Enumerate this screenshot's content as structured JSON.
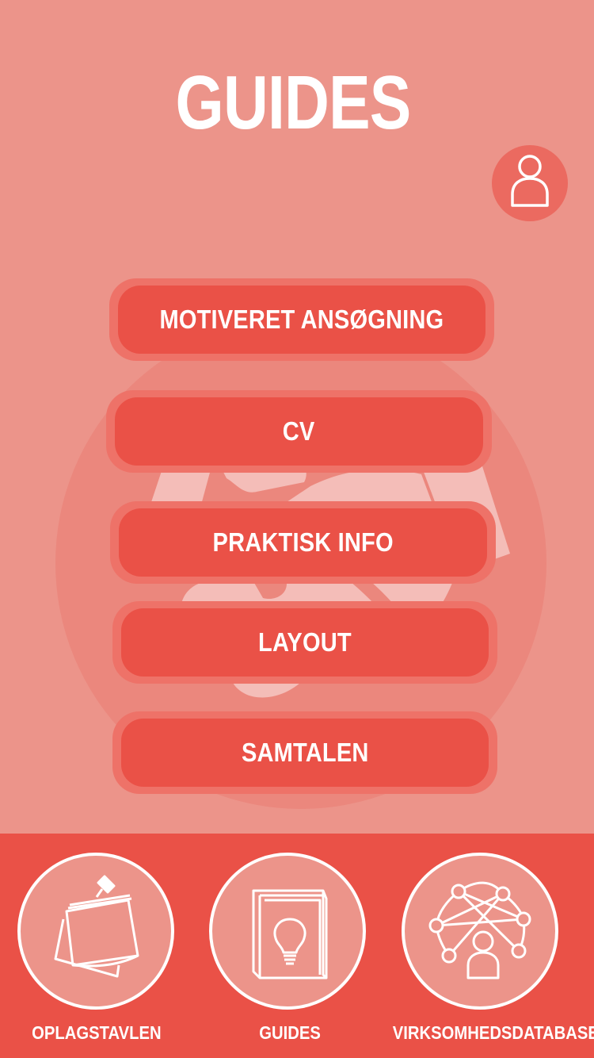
{
  "header": {
    "title": "GUIDES"
  },
  "profile": {
    "icon": "user-icon"
  },
  "guides": [
    {
      "label": "MOTIVERET ANSØGNING"
    },
    {
      "label": "CV"
    },
    {
      "label": "PRAKTISK INFO"
    },
    {
      "label": "LAYOUT"
    },
    {
      "label": "SAMTALEN"
    }
  ],
  "background": {
    "icon": "handshake-icon"
  },
  "nav": [
    {
      "label": "OPLAGSTAVLEN",
      "icon": "sticky-notes-icon"
    },
    {
      "label": "GUIDES",
      "icon": "book-lightbulb-icon"
    },
    {
      "label": "VIRKSOMHEDSDATABASE",
      "icon": "network-icon"
    }
  ],
  "colors": {
    "background": "#ec948a",
    "button_fill": "#ea5147",
    "button_border": "#ee7268",
    "bottom_bar": "#ea5147",
    "text": "#ffffff"
  }
}
